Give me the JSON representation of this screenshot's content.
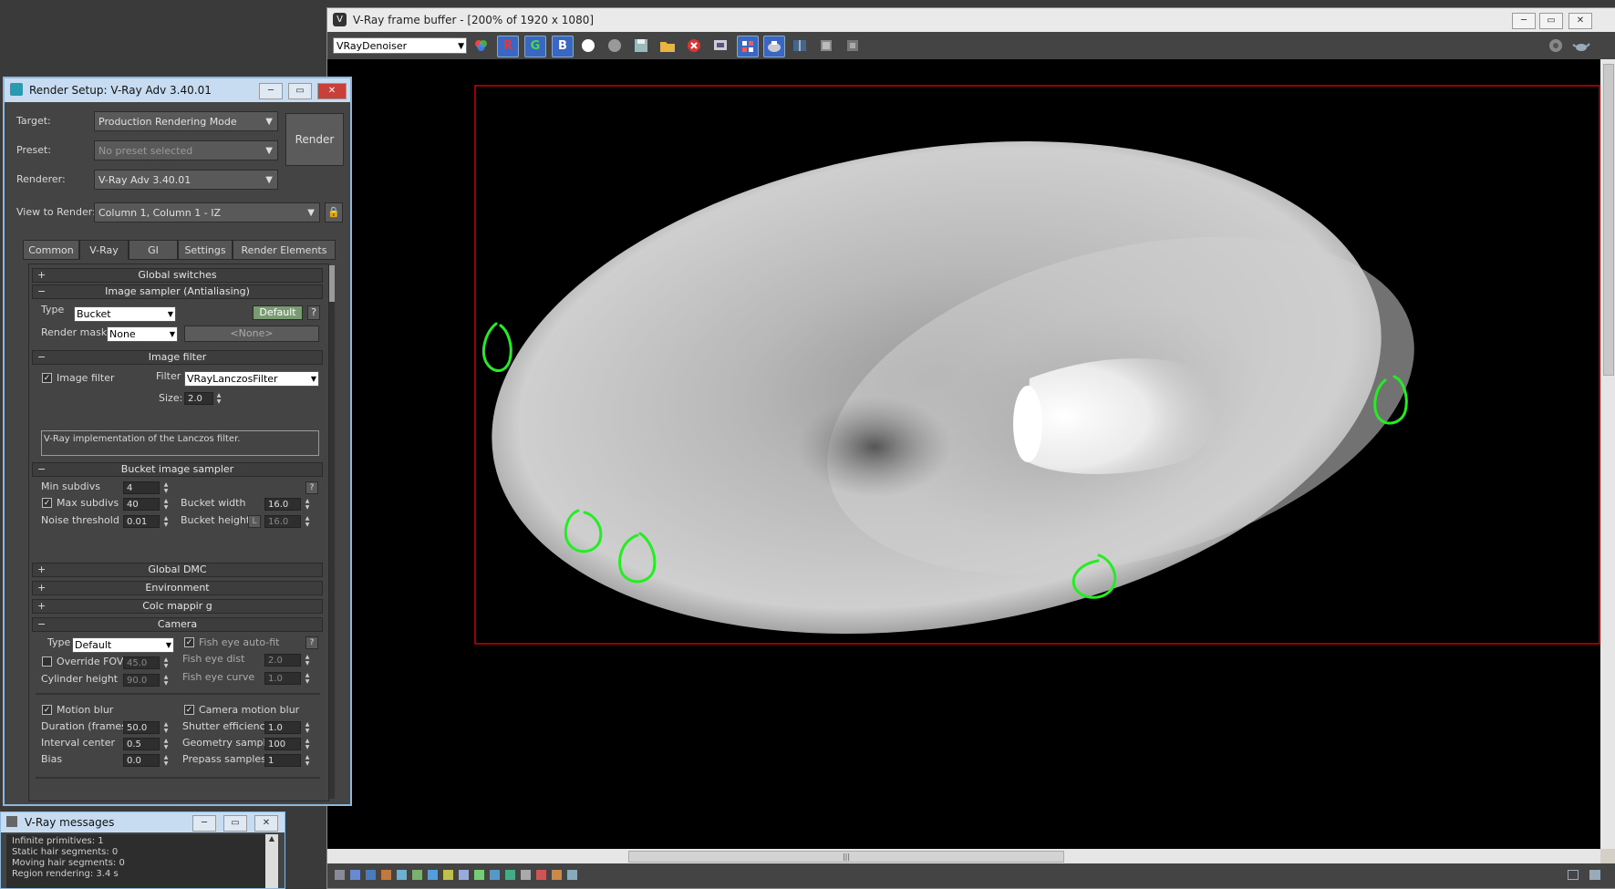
{
  "vfb": {
    "title": "V-Ray frame buffer - [200% of 1920 x 1080]",
    "channel": "VRayDenoiser",
    "tb_r": "R",
    "tb_g": "G",
    "tb_b": "B",
    "win_min": "─",
    "win_max": "▭",
    "win_close": "✕",
    "scroll_grip": "|||"
  },
  "render_setup": {
    "title": "Render Setup: V-Ray Adv 3.40.01",
    "target_label": "Target:",
    "target_value": "Production Rendering Mode",
    "preset_label": "Preset:",
    "preset_value": "No preset selected",
    "renderer_label": "Renderer:",
    "renderer_value": "V-Ray Adv 3.40.01",
    "view_label": "View to Render:",
    "view_value": "Column 1, Column 1 - IZ",
    "render_button": "Render",
    "tabs": [
      "Common",
      "V-Ray",
      "GI",
      "Settings",
      "Render Elements"
    ],
    "rollouts": {
      "global_switches": "Global switches",
      "image_sampler": "Image sampler (Antialiasing)",
      "image_filter": "Image filter",
      "bucket_sampler": "Bucket image sampler",
      "global_dmc": "Global DMC",
      "environment": "Environment",
      "color_mapping": "Colc  mappir g",
      "camera": "Camera"
    },
    "sampler": {
      "type_label": "Type",
      "type_value": "Bucket",
      "default_button": "Default",
      "help": "?",
      "render_mask_label": "Render mask",
      "render_mask_value": "None",
      "mask_none": "<None>"
    },
    "filter": {
      "image_filter_label": "Image filter",
      "filter_label": "Filter",
      "filter_value": "VRayLanczosFilter",
      "size_label": "Size:",
      "size_value": "2.0",
      "description": "V-Ray implementation of the Lanczos filter."
    },
    "bucket": {
      "min_subdivs_label": "Min subdivs",
      "min_subdivs": "4",
      "max_subdivs_label": "Max subdivs",
      "max_subdivs": "40",
      "noise_label": "Noise threshold",
      "noise": "0.01",
      "bucket_width_label": "Bucket width",
      "bucket_width": "16.0",
      "bucket_height_label": "Bucket height",
      "bucket_height_lock": "L",
      "bucket_height": "16.0"
    },
    "camera": {
      "type_label": "Type",
      "type_value": "Default",
      "fish_autofit": "Fish eye auto-fit",
      "override_fov": "Override FOV",
      "fov": "45.0",
      "fish_dist_label": "Fish eye dist",
      "fish_dist": "2.0",
      "cyl_height_label": "Cylinder height",
      "cyl_height": "90.0",
      "fish_curve_label": "Fish eye curve",
      "fish_curve": "1.0",
      "motion_blur": "Motion blur",
      "camera_motion_blur": "Camera motion blur",
      "duration_label": "Duration (frames)",
      "duration": "50.0",
      "shutter_label": "Shutter efficiency",
      "shutter": "1.0",
      "interval_label": "Interval center",
      "interval": "0.5",
      "geo_samples_label": "Geometry samples",
      "geo_samples": "100",
      "bias_label": "Bias",
      "bias": "0.0",
      "prepass_label": "Prepass samples",
      "prepass": "1"
    }
  },
  "messages": {
    "title": "V-Ray messages",
    "lines": [
      "Infinite primitives: 1",
      "Static hair segments: 0",
      "Moving hair segments: 0",
      "Region rendering: 3.4 s"
    ]
  },
  "colors": {
    "region_border": "#ff0000",
    "annotation": "#22ee22"
  }
}
